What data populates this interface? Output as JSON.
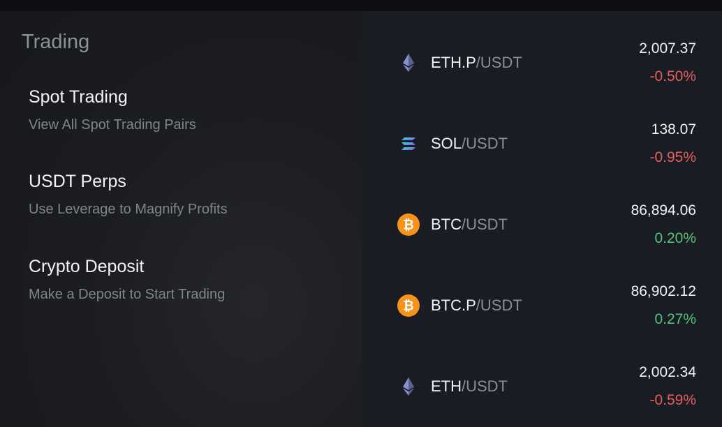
{
  "section": {
    "title": "Trading"
  },
  "menu": [
    {
      "title": "Spot Trading",
      "desc": "View All Spot Trading Pairs"
    },
    {
      "title": "USDT Perps",
      "desc": "Use Leverage to Magnify Profits"
    },
    {
      "title": "Crypto Deposit",
      "desc": "Make a Deposit to Start Trading"
    }
  ],
  "pairs": [
    {
      "base": "ETH.P",
      "quote": "/USDT",
      "price": "2,007.37",
      "change": "-0.50%",
      "direction": "down",
      "icon": "eth-icon"
    },
    {
      "base": "SOL",
      "quote": "/USDT",
      "price": "138.07",
      "change": "-0.95%",
      "direction": "down",
      "icon": "sol-icon"
    },
    {
      "base": "BTC",
      "quote": "/USDT",
      "price": "86,894.06",
      "change": "0.20%",
      "direction": "up",
      "icon": "btc-icon"
    },
    {
      "base": "BTC.P",
      "quote": "/USDT",
      "price": "86,902.12",
      "change": "0.27%",
      "direction": "up",
      "icon": "btc-icon"
    },
    {
      "base": "ETH",
      "quote": "/USDT",
      "price": "2,002.34",
      "change": "-0.59%",
      "direction": "down",
      "icon": "eth-icon"
    }
  ],
  "colors": {
    "negative": "#e55f5f",
    "positive": "#56c27b",
    "btc": "#f7931a"
  }
}
